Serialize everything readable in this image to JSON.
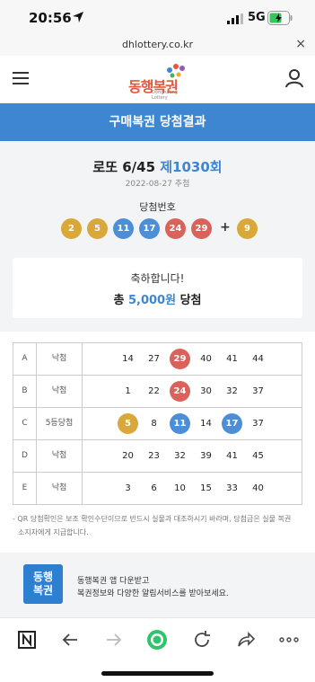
{
  "status_bar": {
    "time": "20:56",
    "network": "5G"
  },
  "browser": {
    "url": "dhlottery.co.kr",
    "close_glyph": "×"
  },
  "header": {
    "logo_text": "동행복권",
    "logo_sub": "Donghaeng Lottery"
  },
  "banner": {
    "title": "구매복권 당첨결과"
  },
  "draw": {
    "game": "로또 6/45",
    "round": "제1030회",
    "date": "2022-08-27 추첨",
    "winning_label": "당첨번호",
    "plus": "+",
    "winning_numbers": [
      {
        "n": "2",
        "color": "#d9a838"
      },
      {
        "n": "5",
        "color": "#d9a838"
      },
      {
        "n": "11",
        "color": "#4d8fd6"
      },
      {
        "n": "17",
        "color": "#4d8fd6"
      },
      {
        "n": "24",
        "color": "#d9625a"
      },
      {
        "n": "29",
        "color": "#d9625a"
      }
    ],
    "bonus": {
      "n": "9",
      "color": "#d9a838"
    }
  },
  "prize": {
    "congrats": "축하합니다!",
    "prefix": "총 ",
    "amount": "5,000원",
    "suffix": " 당첨"
  },
  "results": [
    {
      "letter": "A",
      "status": "낙첨",
      "numbers": [
        "14",
        "27",
        "29",
        "40",
        "41",
        "44"
      ],
      "hits": [
        null,
        null,
        "#d9625a",
        null,
        null,
        null
      ]
    },
    {
      "letter": "B",
      "status": "낙첨",
      "numbers": [
        "1",
        "22",
        "24",
        "30",
        "32",
        "37"
      ],
      "hits": [
        null,
        null,
        "#d9625a",
        null,
        null,
        null
      ]
    },
    {
      "letter": "C",
      "status": "5등당첨",
      "numbers": [
        "5",
        "8",
        "11",
        "14",
        "17",
        "37"
      ],
      "hits": [
        "#d9a838",
        null,
        "#4d8fd6",
        null,
        "#4d8fd6",
        null
      ]
    },
    {
      "letter": "D",
      "status": "낙첨",
      "numbers": [
        "20",
        "23",
        "32",
        "39",
        "41",
        "45"
      ],
      "hits": [
        null,
        null,
        null,
        null,
        null,
        null
      ]
    },
    {
      "letter": "E",
      "status": "낙첨",
      "numbers": [
        "3",
        "6",
        "10",
        "15",
        "33",
        "40"
      ],
      "hits": [
        null,
        null,
        null,
        null,
        null,
        null
      ]
    }
  ],
  "notice": {
    "line1": "- QR 당첨확인은 보조 확인수단이므로 반드시 실물과 대조하시기 바라며, 당첨금은 실물 복권",
    "line2": "소지자에게 지급합니다."
  },
  "promo": {
    "logo_line1": "동행",
    "logo_line2": "복권",
    "line1": "동행복권 앱 다운받고",
    "line2": "복권정보와 다양한 알림서비스를 받아보세요."
  },
  "toolbar": {
    "icons": [
      "naver-n-icon",
      "back-arrow-icon",
      "forward-arrow-icon",
      "green-home-icon",
      "reload-icon",
      "share-icon",
      "more-icon"
    ]
  },
  "colors": {
    "accent": "#3f86d2",
    "yellow_ball": "#d9a838",
    "blue_ball": "#4d8fd6",
    "red_ball": "#d9625a"
  }
}
